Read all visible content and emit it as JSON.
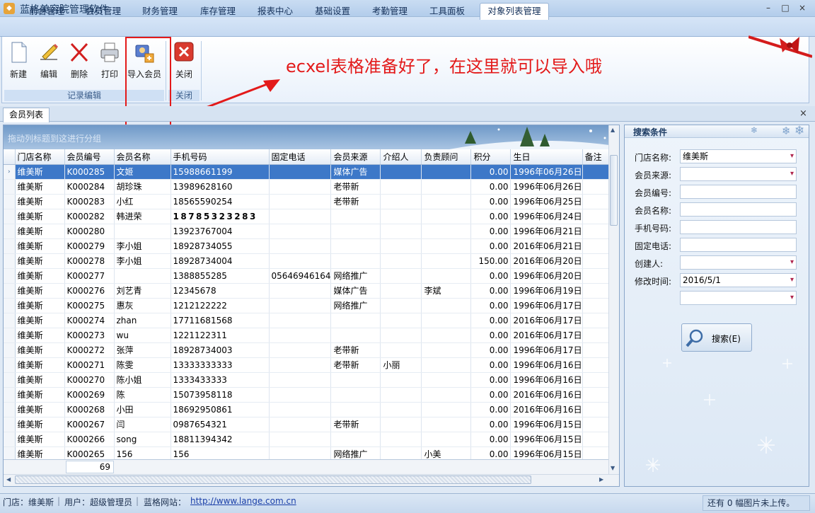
{
  "window": {
    "title": "蓝格美容院管理软件",
    "buttons": [
      "–",
      "□",
      "×"
    ]
  },
  "menu_tabs": [
    "前台管理",
    "会员管理",
    "财务管理",
    "库存管理",
    "报表中心",
    "基础设置",
    "考勤管理",
    "工具面板",
    "对象列表管理"
  ],
  "ribbon": {
    "buttons": {
      "new": "新建",
      "edit": "编辑",
      "delete": "删除",
      "print": "打印",
      "import": "导入会员",
      "close": "关闭"
    },
    "groups": {
      "record_edit": "记录编辑",
      "close": "关闭"
    }
  },
  "annotation": {
    "text": "ecxel表格准备好了，在这里就可以导入哦",
    "color": "#e31a1a"
  },
  "doc_tab": {
    "label": "会员列表",
    "close": "×"
  },
  "grid": {
    "group_hint": "拖动列标题到这进行分组",
    "columns": [
      "门店名称",
      "会员编号",
      "会员名称",
      "手机号码",
      "固定电话",
      "会员来源",
      "介绍人",
      "负责顾问",
      "积分",
      "生日",
      "备注"
    ],
    "rows": [
      [
        "维美斯",
        "K000285",
        "文姬",
        "15988661199",
        "",
        "媒体广告",
        "",
        "",
        "0.00",
        "1996年06月26日",
        ""
      ],
      [
        "维美斯",
        "K000284",
        "胡珍珠",
        "13989628160",
        "",
        "老带新",
        "",
        "",
        "0.00",
        "1996年06月26日",
        ""
      ],
      [
        "维美斯",
        "K000283",
        "小红",
        "18565590254",
        "",
        "老带新",
        "",
        "",
        "0.00",
        "1996年06月25日",
        ""
      ],
      [
        "维美斯",
        "K000282",
        "韩进荣",
        "18785323283",
        "",
        "",
        "",
        "",
        "0.00",
        "1996年06月24日",
        ""
      ],
      [
        "维美斯",
        "K000280",
        "",
        "13923767004",
        "",
        "",
        "",
        "",
        "0.00",
        "1996年06月21日",
        ""
      ],
      [
        "维美斯",
        "K000279",
        "李小姐",
        "18928734055",
        "",
        "",
        "",
        "",
        "0.00",
        "2016年06月21日",
        ""
      ],
      [
        "维美斯",
        "K000278",
        "李小姐",
        "18928734004",
        "",
        "",
        "",
        "",
        "150.00",
        "2016年06月20日",
        ""
      ],
      [
        "维美斯",
        "K000277",
        "",
        "1388855285",
        "05646946164",
        "网络推广",
        "",
        "",
        "0.00",
        "1996年06月20日",
        ""
      ],
      [
        "维美斯",
        "K000276",
        "刘艺青",
        "12345678",
        "",
        "媒体广告",
        "",
        "李斌",
        "0.00",
        "1996年06月19日",
        ""
      ],
      [
        "维美斯",
        "K000275",
        "惠灰",
        "1212122222",
        "",
        "网络推广",
        "",
        "",
        "0.00",
        "1996年06月17日",
        ""
      ],
      [
        "维美斯",
        "K000274",
        "zhan",
        "17711681568",
        "",
        "",
        "",
        "",
        "0.00",
        "2016年06月17日",
        ""
      ],
      [
        "维美斯",
        "K000273",
        "wu",
        "1221122311",
        "",
        "",
        "",
        "",
        "0.00",
        "2016年06月17日",
        ""
      ],
      [
        "维美斯",
        "K000272",
        "张萍",
        "18928734003",
        "",
        "老带新",
        "",
        "",
        "0.00",
        "1996年06月17日",
        ""
      ],
      [
        "维美斯",
        "K000271",
        "陈雯",
        "13333333333",
        "",
        "老带新",
        "小丽",
        "",
        "0.00",
        "1996年06月16日",
        ""
      ],
      [
        "维美斯",
        "K000270",
        "陈小姐",
        "1333433333",
        "",
        "",
        "",
        "",
        "0.00",
        "1996年06月16日",
        ""
      ],
      [
        "维美斯",
        "K000269",
        "陈",
        "15073958118",
        "",
        "",
        "",
        "",
        "0.00",
        "2016年06月16日",
        ""
      ],
      [
        "维美斯",
        "K000268",
        "小田",
        "18692950861",
        "",
        "",
        "",
        "",
        "0.00",
        "2016年06月16日",
        ""
      ],
      [
        "维美斯",
        "K000267",
        "闫",
        "0987654321",
        "",
        "老带新",
        "",
        "",
        "0.00",
        "1996年06月15日",
        ""
      ],
      [
        "维美斯",
        "K000266",
        "song",
        "18811394342",
        "",
        "",
        "",
        "",
        "0.00",
        "1996年06月15日",
        ""
      ],
      [
        "维美斯",
        "K000265",
        "156",
        "156",
        "",
        "网络推广",
        "",
        "小美",
        "0.00",
        "1996年06月15日",
        ""
      ]
    ],
    "footer_count": "69"
  },
  "search": {
    "title": "搜索条件",
    "fields": [
      {
        "label": "门店名称:",
        "value": "维美斯",
        "dropdown": true
      },
      {
        "label": "会员来源:",
        "value": "",
        "dropdown": true
      },
      {
        "label": "会员编号:",
        "value": "",
        "dropdown": false
      },
      {
        "label": "会员名称:",
        "value": "",
        "dropdown": false
      },
      {
        "label": "手机号码:",
        "value": "",
        "dropdown": false
      },
      {
        "label": "固定电话:",
        "value": "",
        "dropdown": false
      },
      {
        "label": "创建人:",
        "value": "",
        "dropdown": true
      },
      {
        "label": "修改时间:",
        "value": "2016/5/1",
        "dropdown": true
      },
      {
        "label": "",
        "value": "",
        "dropdown": true
      }
    ],
    "button": "搜索(E)"
  },
  "status": {
    "store": "门店：维美斯",
    "user": "用户：超级管理员",
    "site_label": "蓝格网站：",
    "site_url": "http://www.lange.com.cn",
    "right": "还有 0 幅图片未上传。"
  },
  "colors": {
    "accent": "#3d78c8",
    "annotation": "#e31a1a"
  }
}
